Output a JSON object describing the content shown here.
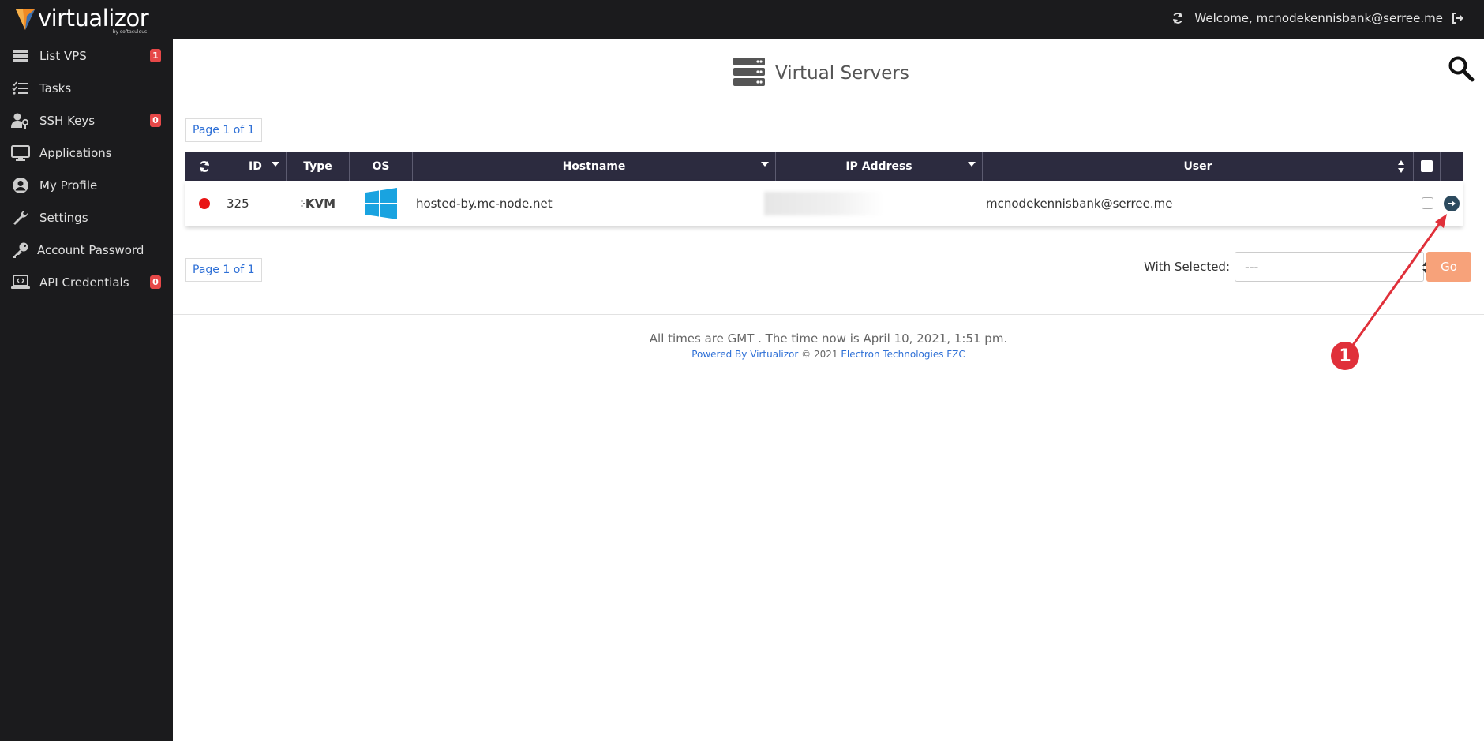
{
  "app": {
    "logo_text": "virtualizor",
    "logo_sub": "by softaculous",
    "welcome_text": "Welcome, mcnodekennisbank@serree.me"
  },
  "sidebar": {
    "items": [
      {
        "label": "List VPS",
        "icon": "server-list-icon",
        "badge": "1"
      },
      {
        "label": "Tasks",
        "icon": "tasks-icon",
        "badge": ""
      },
      {
        "label": "SSH Keys",
        "icon": "user-key-icon",
        "badge": "0"
      },
      {
        "label": "Applications",
        "icon": "monitor-icon",
        "badge": ""
      },
      {
        "label": "My Profile",
        "icon": "user-circle-icon",
        "badge": ""
      },
      {
        "label": "Settings",
        "icon": "wrench-icon",
        "badge": ""
      },
      {
        "label": "Account Password",
        "icon": "key-icon",
        "badge": ""
      },
      {
        "label": "API Credentials",
        "icon": "laptop-code-icon",
        "badge": "0"
      }
    ]
  },
  "main": {
    "title": "Virtual Servers",
    "pager_top": "Page 1 of 1",
    "pager_bottom": "Page 1 of 1",
    "columns": [
      "ID",
      "Type",
      "OS",
      "Hostname",
      "IP Address",
      "User"
    ],
    "rows": [
      {
        "status": "stopped",
        "id": "325",
        "type": "KVM",
        "os": "windows-logo-icon",
        "hostname": "hosted-by.mc-node.net",
        "ip": "",
        "user": "mcnodekennisbank@serree.me"
      }
    ],
    "with_selected_label": "With Selected:",
    "with_selected_value": "---",
    "go_label": "Go"
  },
  "footer": {
    "line1": "All times are GMT . The time now is April 10, 2021, 1:51 pm.",
    "powered_by": "Powered By",
    "virtualizor_link": "Virtualizor",
    "copyright": "© 2021",
    "company_link": "Electron Technologies FZC"
  },
  "annotation": {
    "number": "1"
  },
  "colors": {
    "sidebar_bg": "#1b1b1d",
    "grid_header_bg": "#2c2b3f",
    "badge": "#e64848",
    "go_button": "#f7a27a",
    "link": "#2d6fd6",
    "status_stopped": "#e81414",
    "annotation": "#e0303a"
  }
}
